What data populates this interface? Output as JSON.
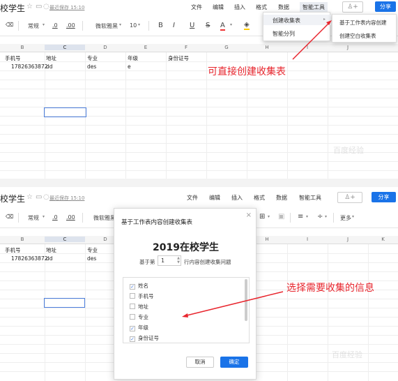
{
  "top": {
    "title": "校学生",
    "saved": "最近保存 15:10",
    "menus": [
      "文件",
      "编辑",
      "插入",
      "格式",
      "数据",
      "智能工具"
    ],
    "user_icon": "user-plus-icon",
    "share": "分享"
  },
  "toolbar": {
    "style": "常规",
    "dec1": ".0",
    "dec2": ".00",
    "font": "微软雅黑",
    "size": "10",
    "bold": "B",
    "italic": "I",
    "underline": "U",
    "strike": "S",
    "color": "A",
    "more": "更多"
  },
  "columns1": [
    "B",
    "C",
    "D",
    "E",
    "F",
    "G",
    "H",
    "I",
    "J"
  ],
  "columns2": [
    "B",
    "C",
    "D",
    "H",
    "I",
    "J",
    "K"
  ],
  "sheet": {
    "headers": [
      "手机号",
      "地址",
      "专业",
      "年级",
      "身份证号"
    ],
    "row": [
      "17826363872",
      "dd",
      "des",
      "e"
    ]
  },
  "dropdown": {
    "items": [
      "创建收集表",
      "智能分列"
    ],
    "sub": [
      "基于工作表内容创建",
      "创建空白收集表"
    ]
  },
  "annotation1": "可直接创建收集表",
  "annotation2": "选择需要收集的信息",
  "watermark": "百度经验",
  "modal": {
    "title": "基于工作表内容创建收集表",
    "sheet_name": "2019在校学生",
    "row_prefix": "基于第",
    "row_value": "1",
    "row_suffix": "行内容创建收集问题",
    "fields": [
      {
        "label": "姓名",
        "checked": true
      },
      {
        "label": "手机号",
        "checked": false
      },
      {
        "label": "地址",
        "checked": false
      },
      {
        "label": "专业",
        "checked": false
      },
      {
        "label": "年级",
        "checked": true
      },
      {
        "label": "身份证号",
        "checked": true
      }
    ],
    "cancel": "取消",
    "ok": "确定"
  },
  "colors": {
    "accent": "#1a73e8",
    "annotation": "#e8262e"
  }
}
